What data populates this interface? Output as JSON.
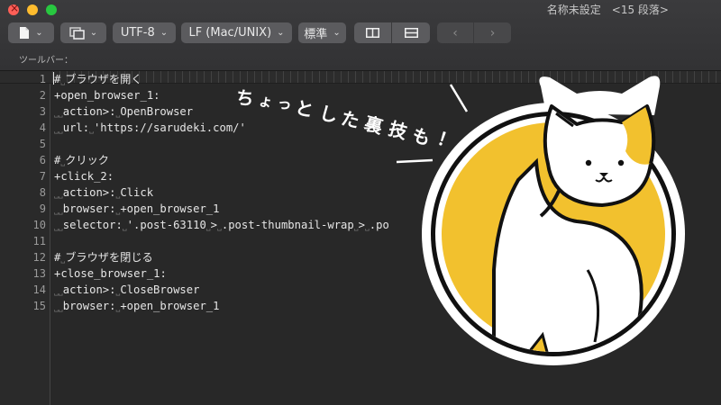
{
  "window": {
    "title": "名称未設定　<15 段落>"
  },
  "toolbar": {
    "encoding": "UTF-8",
    "line_ending": "LF (Mac/UNIX)",
    "style": "標準",
    "label": "ツールバー："
  },
  "editor": {
    "line_numbers": [
      "1",
      "2",
      "3",
      "4",
      "5",
      "6",
      "7",
      "8",
      "9",
      "10",
      "11",
      "12",
      "13",
      "14",
      "15"
    ],
    "lines": [
      "#␣ブラウザを開く",
      "+open_browser_1:",
      "␣␣action>:␣OpenBrowser",
      "␣␣url:␣'https://sarudeki.com/'",
      "",
      "#␣クリック",
      "+click_2:",
      "␣␣action>:␣Click",
      "␣␣browser:␣+open_browser_1",
      "␣␣selector:␣'.post-63110␣>␣.post-thumbnail-wrap␣>␣.po                            er'",
      "",
      "#␣ブラウザを閉じる",
      "+close_browser_1:",
      "␣␣action>:␣CloseBrowser",
      "␣␣browser:␣+open_browser_1"
    ]
  },
  "overlay": {
    "caption": "ちょっとした裏技も！",
    "caption_chars": [
      "ち",
      "ょ",
      "っ",
      "と",
      "し",
      "た",
      "裏",
      "技",
      "も",
      "！"
    ],
    "accent_color": "#f2c12e",
    "outline_color": "#111111"
  }
}
